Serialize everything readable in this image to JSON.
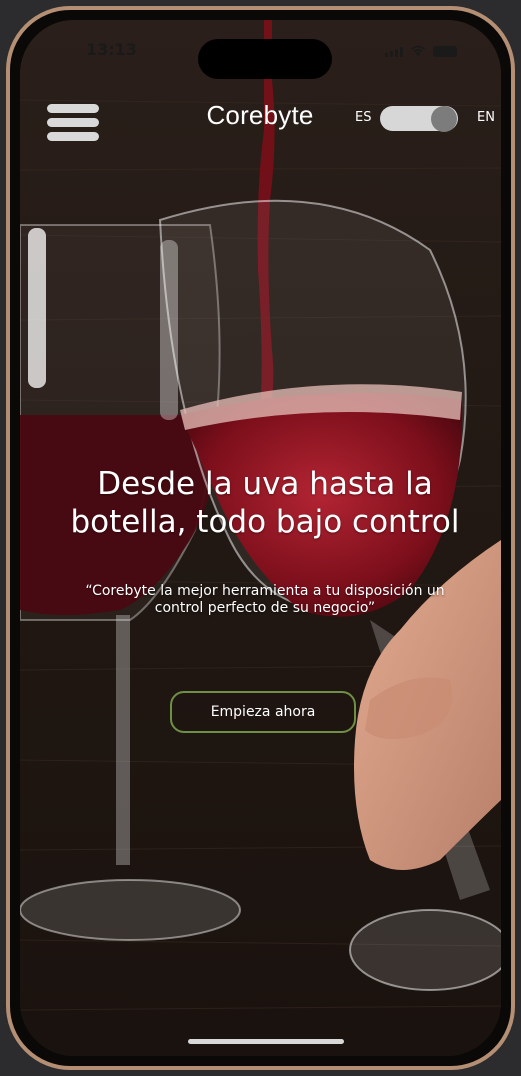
{
  "status_bar": {
    "time": "13:13"
  },
  "header": {
    "brand": "Corebyte",
    "lang_left": "ES",
    "lang_right": "EN"
  },
  "hero": {
    "title_line1": "Desde la uva hasta la",
    "title_line2": "botella, todo bajo control",
    "quote_line1": "“Corebyte la mejor herramienta a tu disposición un",
    "quote_line2": "control perfecto de su negocio”",
    "cta_label": "Empieza ahora"
  },
  "colors": {
    "frame": "#b48f73",
    "wine": "#8e1420",
    "cta_border": "#6f8f45",
    "toggle_track": "#d7d7d7",
    "toggle_knob": "#7c7c7c"
  }
}
